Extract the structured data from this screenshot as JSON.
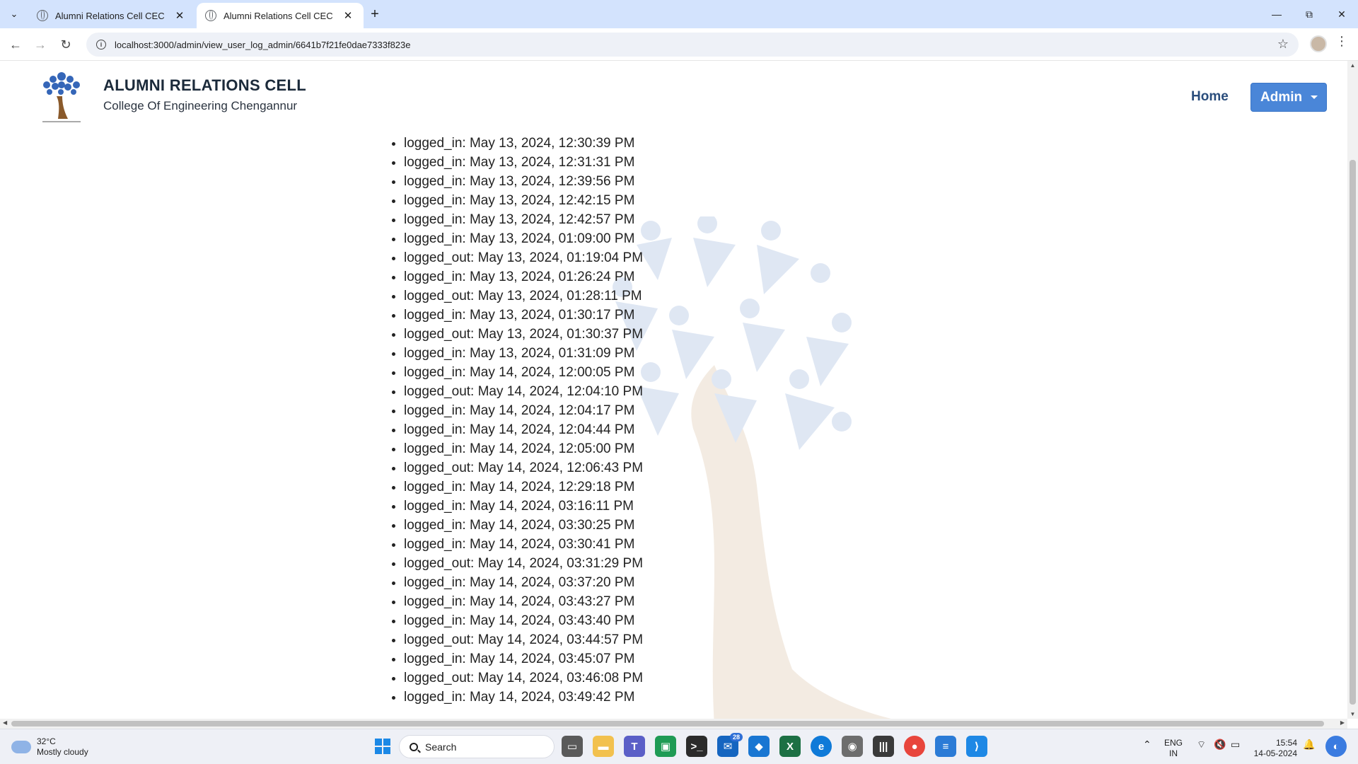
{
  "browser": {
    "tabs": [
      {
        "title": "Alumni Relations Cell CEC",
        "active": false
      },
      {
        "title": "Alumni Relations Cell CEC",
        "active": true
      }
    ],
    "url": "localhost:3000/admin/view_user_log_admin/6641b7f21fe0dae7333f823e"
  },
  "header": {
    "title": "ALUMNI RELATIONS CELL",
    "subtitle": "College Of Engineering Chengannur",
    "nav": {
      "home": "Home",
      "admin": "Admin"
    }
  },
  "logs": [
    "logged_in: May 13, 2024, 12:30:39 PM",
    "logged_in: May 13, 2024, 12:31:31 PM",
    "logged_in: May 13, 2024, 12:39:56 PM",
    "logged_in: May 13, 2024, 12:42:15 PM",
    "logged_in: May 13, 2024, 12:42:57 PM",
    "logged_in: May 13, 2024, 01:09:00 PM",
    "logged_out: May 13, 2024, 01:19:04 PM",
    "logged_in: May 13, 2024, 01:26:24 PM",
    "logged_out: May 13, 2024, 01:28:11 PM",
    "logged_in: May 13, 2024, 01:30:17 PM",
    "logged_out: May 13, 2024, 01:30:37 PM",
    "logged_in: May 13, 2024, 01:31:09 PM",
    "logged_in: May 14, 2024, 12:00:05 PM",
    "logged_out: May 14, 2024, 12:04:10 PM",
    "logged_in: May 14, 2024, 12:04:17 PM",
    "logged_in: May 14, 2024, 12:04:44 PM",
    "logged_in: May 14, 2024, 12:05:00 PM",
    "logged_out: May 14, 2024, 12:06:43 PM",
    "logged_in: May 14, 2024, 12:29:18 PM",
    "logged_in: May 14, 2024, 03:16:11 PM",
    "logged_in: May 14, 2024, 03:30:25 PM",
    "logged_in: May 14, 2024, 03:30:41 PM",
    "logged_out: May 14, 2024, 03:31:29 PM",
    "logged_in: May 14, 2024, 03:37:20 PM",
    "logged_in: May 14, 2024, 03:43:27 PM",
    "logged_in: May 14, 2024, 03:43:40 PM",
    "logged_out: May 14, 2024, 03:44:57 PM",
    "logged_in: May 14, 2024, 03:45:07 PM",
    "logged_out: May 14, 2024, 03:46:08 PM",
    "logged_in: May 14, 2024, 03:49:42 PM"
  ],
  "taskbar": {
    "weather": {
      "temp": "32°C",
      "condition": "Mostly cloudy"
    },
    "search_placeholder": "Search",
    "mail_badge": "28",
    "lang": {
      "line1": "ENG",
      "line2": "IN"
    },
    "clock": {
      "time": "15:54",
      "date": "14-05-2024"
    }
  },
  "colors": {
    "tabbar": "#d3e3fd",
    "admin_button": "#4a86d8",
    "home_link": "#2a4d7c",
    "brand_title": "#1b2a3a"
  }
}
